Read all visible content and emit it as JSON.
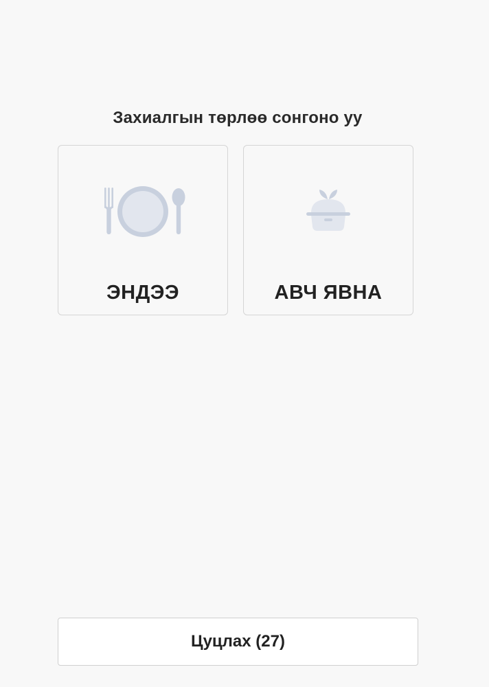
{
  "heading": "Захиалгын төрлөө сонгоно уу",
  "options": [
    {
      "label": "ЭНДЭЭ",
      "icon": "plate-cutlery-icon"
    },
    {
      "label": "АВЧ ЯВНА",
      "icon": "takeaway-box-icon"
    }
  ],
  "cancel_button": {
    "label": "Цуцлах (27)"
  },
  "colors": {
    "background": "#f8f8f8",
    "icon_light": "#e2e6ee",
    "icon_dark": "#c8d0de",
    "card_border": "#d5d5d5"
  }
}
